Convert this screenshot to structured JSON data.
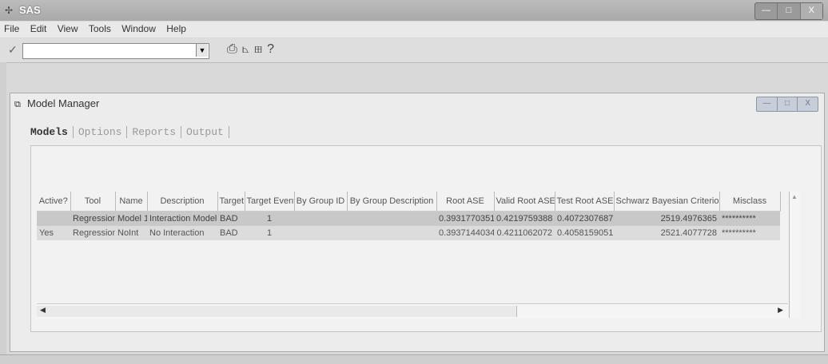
{
  "window": {
    "title": "SAS",
    "controls": [
      "—",
      "□",
      "X"
    ]
  },
  "menu": [
    "File",
    "Edit",
    "View",
    "Tools",
    "Window",
    "Help"
  ],
  "toolbar": {
    "command_value": "",
    "icons": [
      "print-icon",
      "graph-icon",
      "chart-icon",
      "help-icon"
    ]
  },
  "model_manager": {
    "title": "Model Manager",
    "controls": [
      "—",
      "□",
      "X"
    ],
    "tabs": [
      "Models",
      "Options",
      "Reports",
      "Output"
    ],
    "columns": [
      "Active?",
      "Tool",
      "Name",
      "Description",
      "Target",
      "Target Event",
      "By Group ID",
      "By Group Description",
      "Root ASE",
      "Valid Root ASE",
      "Test Root ASE",
      "Schwarz Bayesian Criterion",
      "Misclass"
    ],
    "rows": [
      [
        "",
        "Regression",
        "Model 1",
        "Interaction Model",
        "BAD",
        "1",
        "",
        "",
        "0.3931770351",
        "0.4219759388",
        "0.4072307687",
        "2519.4976365",
        "**********"
      ],
      [
        "Yes",
        "Regression",
        "NoInt",
        "No Interaction",
        "BAD",
        "1",
        "",
        "",
        "0.3937144034",
        "0.4211062072",
        "0.4058159051",
        "2521.4077728",
        "**********"
      ]
    ]
  }
}
